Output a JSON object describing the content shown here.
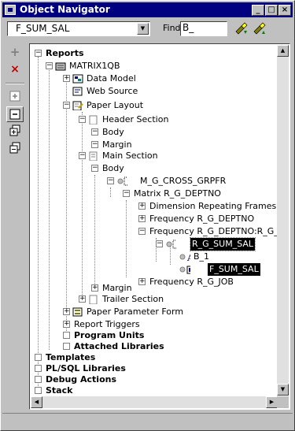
{
  "window": {
    "title": "Object Navigator"
  },
  "toolbar": {
    "context_value": "F_SUM_SAL",
    "find_label": "Find:",
    "find_value": "B_"
  },
  "tree": {
    "reports": "Reports",
    "matrix": "MATRIX1QB",
    "data_model": "Data Model",
    "web_source": "Web Source",
    "paper_layout": "Paper Layout",
    "header_section": "Header Section",
    "header_body": "Body",
    "header_margin": "Margin",
    "main_section": "Main Section",
    "main_body": "Body",
    "m_g_cross": "M_G_CROSS_GRPFR",
    "matrix_r": "Matrix R_G_DEPTNO",
    "dim_frames": "Dimension Repeating Frames",
    "freq_deptno": "Frequency R_G_DEPTNO",
    "freq_deptno_j": "Frequency R_G_DEPTNO:R_G_J",
    "r_g_sum_sal": "R_G_SUM_SAL",
    "b_1": "B_1",
    "f_sum_sal": "F_SUM_SAL",
    "freq_job": "Frequency R_G_JOB",
    "main_margin": "Margin",
    "trailer_section": "Trailer Section",
    "paper_param": "Paper Parameter Form",
    "report_triggers": "Report Triggers",
    "program_units": "Program Units",
    "attached_libs": "Attached Libraries",
    "templates": "Templates",
    "plsql_libs": "PL/SQL Libraries",
    "debug_actions": "Debug Actions",
    "stack": "Stack"
  }
}
